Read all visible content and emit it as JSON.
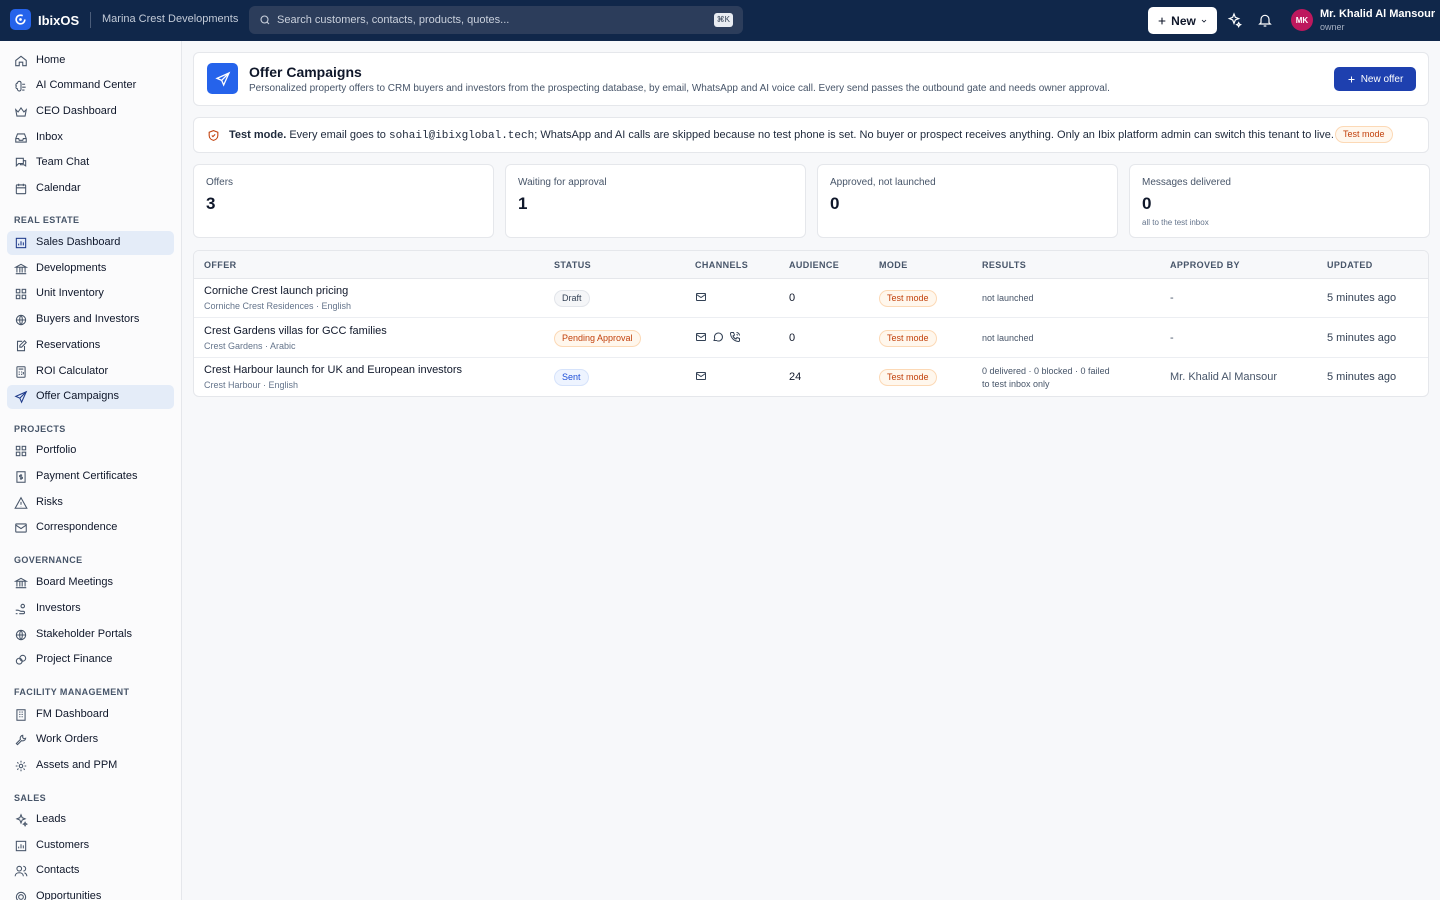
{
  "topbar": {
    "app_name": "IbixOS",
    "tenant": "Marina Crest Developments",
    "search_placeholder": "Search customers, contacts, products, quotes...",
    "search_shortcut": "⌘K",
    "new_label": "New",
    "user_initials": "MK",
    "user_name": "Mr. Khalid Al Mansour",
    "user_role": "owner",
    "avatar_color": "#be185d"
  },
  "sidebar": {
    "top_items": [
      "Home",
      "AI Command Center",
      "CEO Dashboard",
      "Inbox",
      "Team Chat",
      "Calendar"
    ],
    "sections": [
      {
        "title": "REAL ESTATE",
        "items": [
          "Sales Dashboard",
          "Developments",
          "Unit Inventory",
          "Buyers and Investors",
          "Reservations",
          "ROI Calculator",
          "Offer Campaigns"
        ]
      },
      {
        "title": "PROJECTS",
        "items": [
          "Portfolio",
          "Payment Certificates",
          "Risks",
          "Correspondence"
        ]
      },
      {
        "title": "GOVERNANCE",
        "items": [
          "Board Meetings",
          "Investors",
          "Stakeholder Portals",
          "Project Finance"
        ]
      },
      {
        "title": "FACILITY MANAGEMENT",
        "items": [
          "FM Dashboard",
          "Work Orders",
          "Assets and PPM"
        ]
      },
      {
        "title": "SALES",
        "items": [
          "Leads",
          "Customers",
          "Contacts",
          "Opportunities"
        ]
      }
    ],
    "active_items": [
      "Sales Dashboard",
      "Offer Campaigns"
    ]
  },
  "header": {
    "title": "Offer Campaigns",
    "subtitle": "Personalized property offers to CRM buyers and investors from the prospecting database, by email, WhatsApp and AI voice call. Every send passes the outbound gate and needs owner approval.",
    "new_offer_label": "New offer"
  },
  "banner": {
    "bold": "Test mode.",
    "text_before": " Every email goes to ",
    "email": "sohail@ibixglobal.tech",
    "text_after": "; WhatsApp and AI calls are skipped because no test phone is set. No buyer or prospect receives anything. Only an Ibix platform admin can switch this tenant to live.",
    "badge": "Test mode"
  },
  "stats": [
    {
      "label": "Offers",
      "value": "3",
      "note": ""
    },
    {
      "label": "Waiting for approval",
      "value": "1",
      "note": ""
    },
    {
      "label": "Approved, not launched",
      "value": "0",
      "note": ""
    },
    {
      "label": "Messages delivered",
      "value": "0",
      "note": "all to the test inbox"
    }
  ],
  "table": {
    "columns": [
      "OFFER",
      "STATUS",
      "CHANNELS",
      "AUDIENCE",
      "MODE",
      "RESULTS",
      "APPROVED BY",
      "UPDATED"
    ],
    "rows": [
      {
        "offer": "Corniche Crest launch pricing",
        "meta": "Corniche Crest Residences · English",
        "status": "Draft",
        "status_kind": "draft",
        "channels": [
          "mail-icon"
        ],
        "audience": "0",
        "mode": "Test mode",
        "results": [
          "not launched"
        ],
        "approved_by": "-",
        "updated": "5 minutes ago"
      },
      {
        "offer": "Crest Gardens villas for GCC families",
        "meta": "Crest Gardens · Arabic",
        "status": "Pending Approval",
        "status_kind": "pending",
        "channels": [
          "mail-icon",
          "chat-icon",
          "phone-icon"
        ],
        "audience": "0",
        "mode": "Test mode",
        "results": [
          "not launched"
        ],
        "approved_by": "-",
        "updated": "5 minutes ago"
      },
      {
        "offer": "Crest Harbour launch for UK and European investors",
        "meta": "Crest Harbour · English",
        "status": "Sent",
        "status_kind": "sent",
        "channels": [
          "mail-icon"
        ],
        "audience": "24",
        "mode": "Test mode",
        "results": [
          "0 delivered · 0 blocked · 0 failed",
          "to test inbox only"
        ],
        "approved_by": "Mr. Khalid Al Mansour",
        "updated": "5 minutes ago"
      }
    ]
  },
  "colors": {
    "topbar": "#10274a",
    "accent": "#2563eb",
    "primary_button": "#1e40af",
    "test_mode": "#c2410c"
  }
}
